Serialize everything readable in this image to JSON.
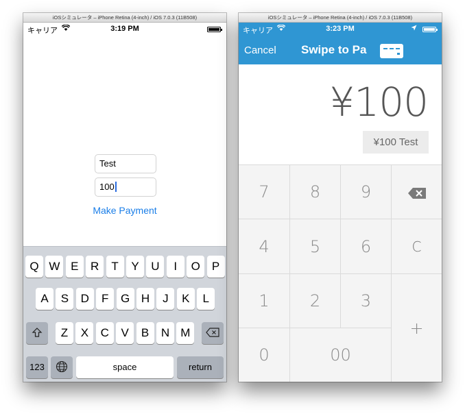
{
  "left_window": {
    "title": "iOSシミュレータ – iPhone Retina (4-inch) / iOS 7.0.3 (11B508)",
    "status": {
      "carrier": "キャリア",
      "time": "3:19 PM",
      "battery_level": 1.0
    },
    "form": {
      "name_value": "Test",
      "amount_value": "100",
      "make_payment_label": "Make Payment"
    },
    "keyboard": {
      "row1": [
        "Q",
        "W",
        "E",
        "R",
        "T",
        "Y",
        "U",
        "I",
        "O",
        "P"
      ],
      "row2": [
        "A",
        "S",
        "D",
        "F",
        "G",
        "H",
        "J",
        "K",
        "L"
      ],
      "row3": [
        "Z",
        "X",
        "C",
        "V",
        "B",
        "N",
        "M"
      ],
      "numbers_label": "123",
      "space_label": "space",
      "return_label": "return",
      "icons": {
        "shift": "shift-icon",
        "delete": "delete-icon",
        "globe": "globe-icon"
      }
    }
  },
  "right_window": {
    "title": "iOSシミュレータ – iPhone Retina (4-inch) / iOS 7.0.3 (11B508)",
    "status": {
      "carrier": "キャリア",
      "time": "3:23 PM",
      "battery_level": 1.0
    },
    "nav": {
      "cancel_label": "Cancel",
      "title": "Swipe to Pa",
      "accent_color": "#2f96d3",
      "card_icon": "card-icon"
    },
    "amount": "¥100",
    "item_chip": "¥100 Test",
    "keypad": {
      "row1": [
        "7",
        "8",
        "9"
      ],
      "row2": [
        "4",
        "5",
        "6"
      ],
      "row3": [
        "1",
        "2",
        "3"
      ],
      "zero": "0",
      "double_zero": "00",
      "clear": "C",
      "plus": "+",
      "backspace_icon": "backspace-icon"
    }
  }
}
